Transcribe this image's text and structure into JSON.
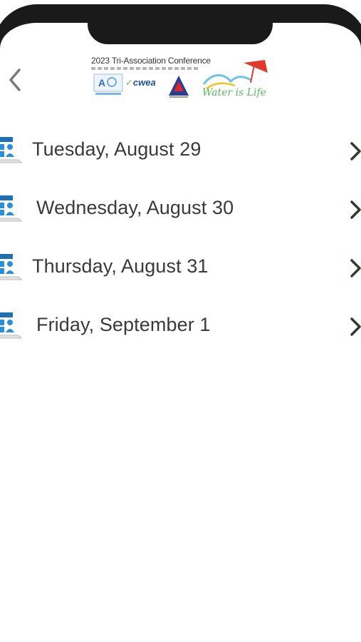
{
  "header": {
    "back_icon": "chevron-left-icon",
    "banner": {
      "title": "2023 Tri-Association Conference",
      "cwea_label": "cwea",
      "tagline": "Water is Life"
    }
  },
  "schedule": {
    "days": [
      {
        "label": "Tuesday, August 29",
        "icon": "schedule-icon",
        "chevron": "chevron-right-icon"
      },
      {
        "label": "Wednesday, August 30",
        "icon": "schedule-icon",
        "chevron": "chevron-right-icon"
      },
      {
        "label": "Thursday, August 31",
        "icon": "schedule-icon",
        "chevron": "chevron-right-icon"
      },
      {
        "label": "Friday, September 1",
        "icon": "schedule-icon",
        "chevron": "chevron-right-icon"
      }
    ]
  },
  "colors": {
    "icon_blue": "#2a8fd6",
    "icon_dark_blue": "#1f6fb5",
    "chevron": "#2e3b2e",
    "text": "#3a3a3a",
    "bezel": "#1a1a1a"
  }
}
